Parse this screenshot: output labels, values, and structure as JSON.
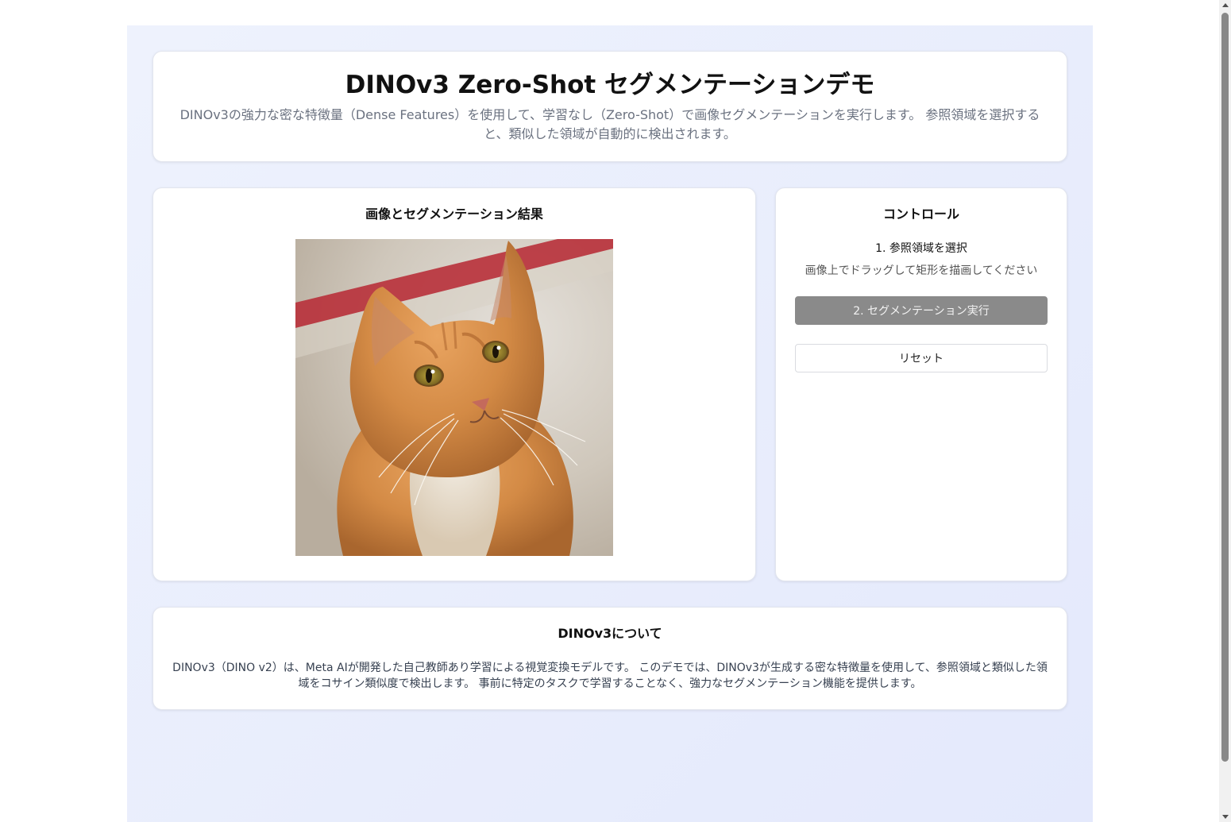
{
  "header": {
    "title": "DINOv3 Zero-Shot セグメンテーションデモ",
    "subtitle": "DINOv3の強力な密な特徴量（Dense Features）を使用して、学習なし（Zero-Shot）で画像セグメンテーションを実行します。 参照領域を選択すると、類似した領域が自動的に検出されます。"
  },
  "image_panel": {
    "title": "画像とセグメンテーション結果",
    "image_icon": "cat-photo"
  },
  "controls": {
    "title": "コントロール",
    "step1_label": "1. 参照領域を選択",
    "step1_hint": "画像上でドラッグして矩形を描画してください",
    "run_button": "2. セグメンテーション実行",
    "reset_button": "リセット"
  },
  "about": {
    "title": "DINOv3について",
    "text": "DINOv3（DINO v2）は、Meta AIが開発した自己教師あり学習による視覚変換モデルです。 このデモでは、DINOv3が生成する密な特徴量を使用して、参照領域と類似した領域をコサイン類似度で検出します。 事前に特定のタスクで学習することなく、強力なセグメンテーション機能を提供します。"
  },
  "colors": {
    "run_button_disabled": "#8a8a8a",
    "background_gradient_start": "#eef2fd",
    "background_gradient_end": "#e4e9fc"
  }
}
